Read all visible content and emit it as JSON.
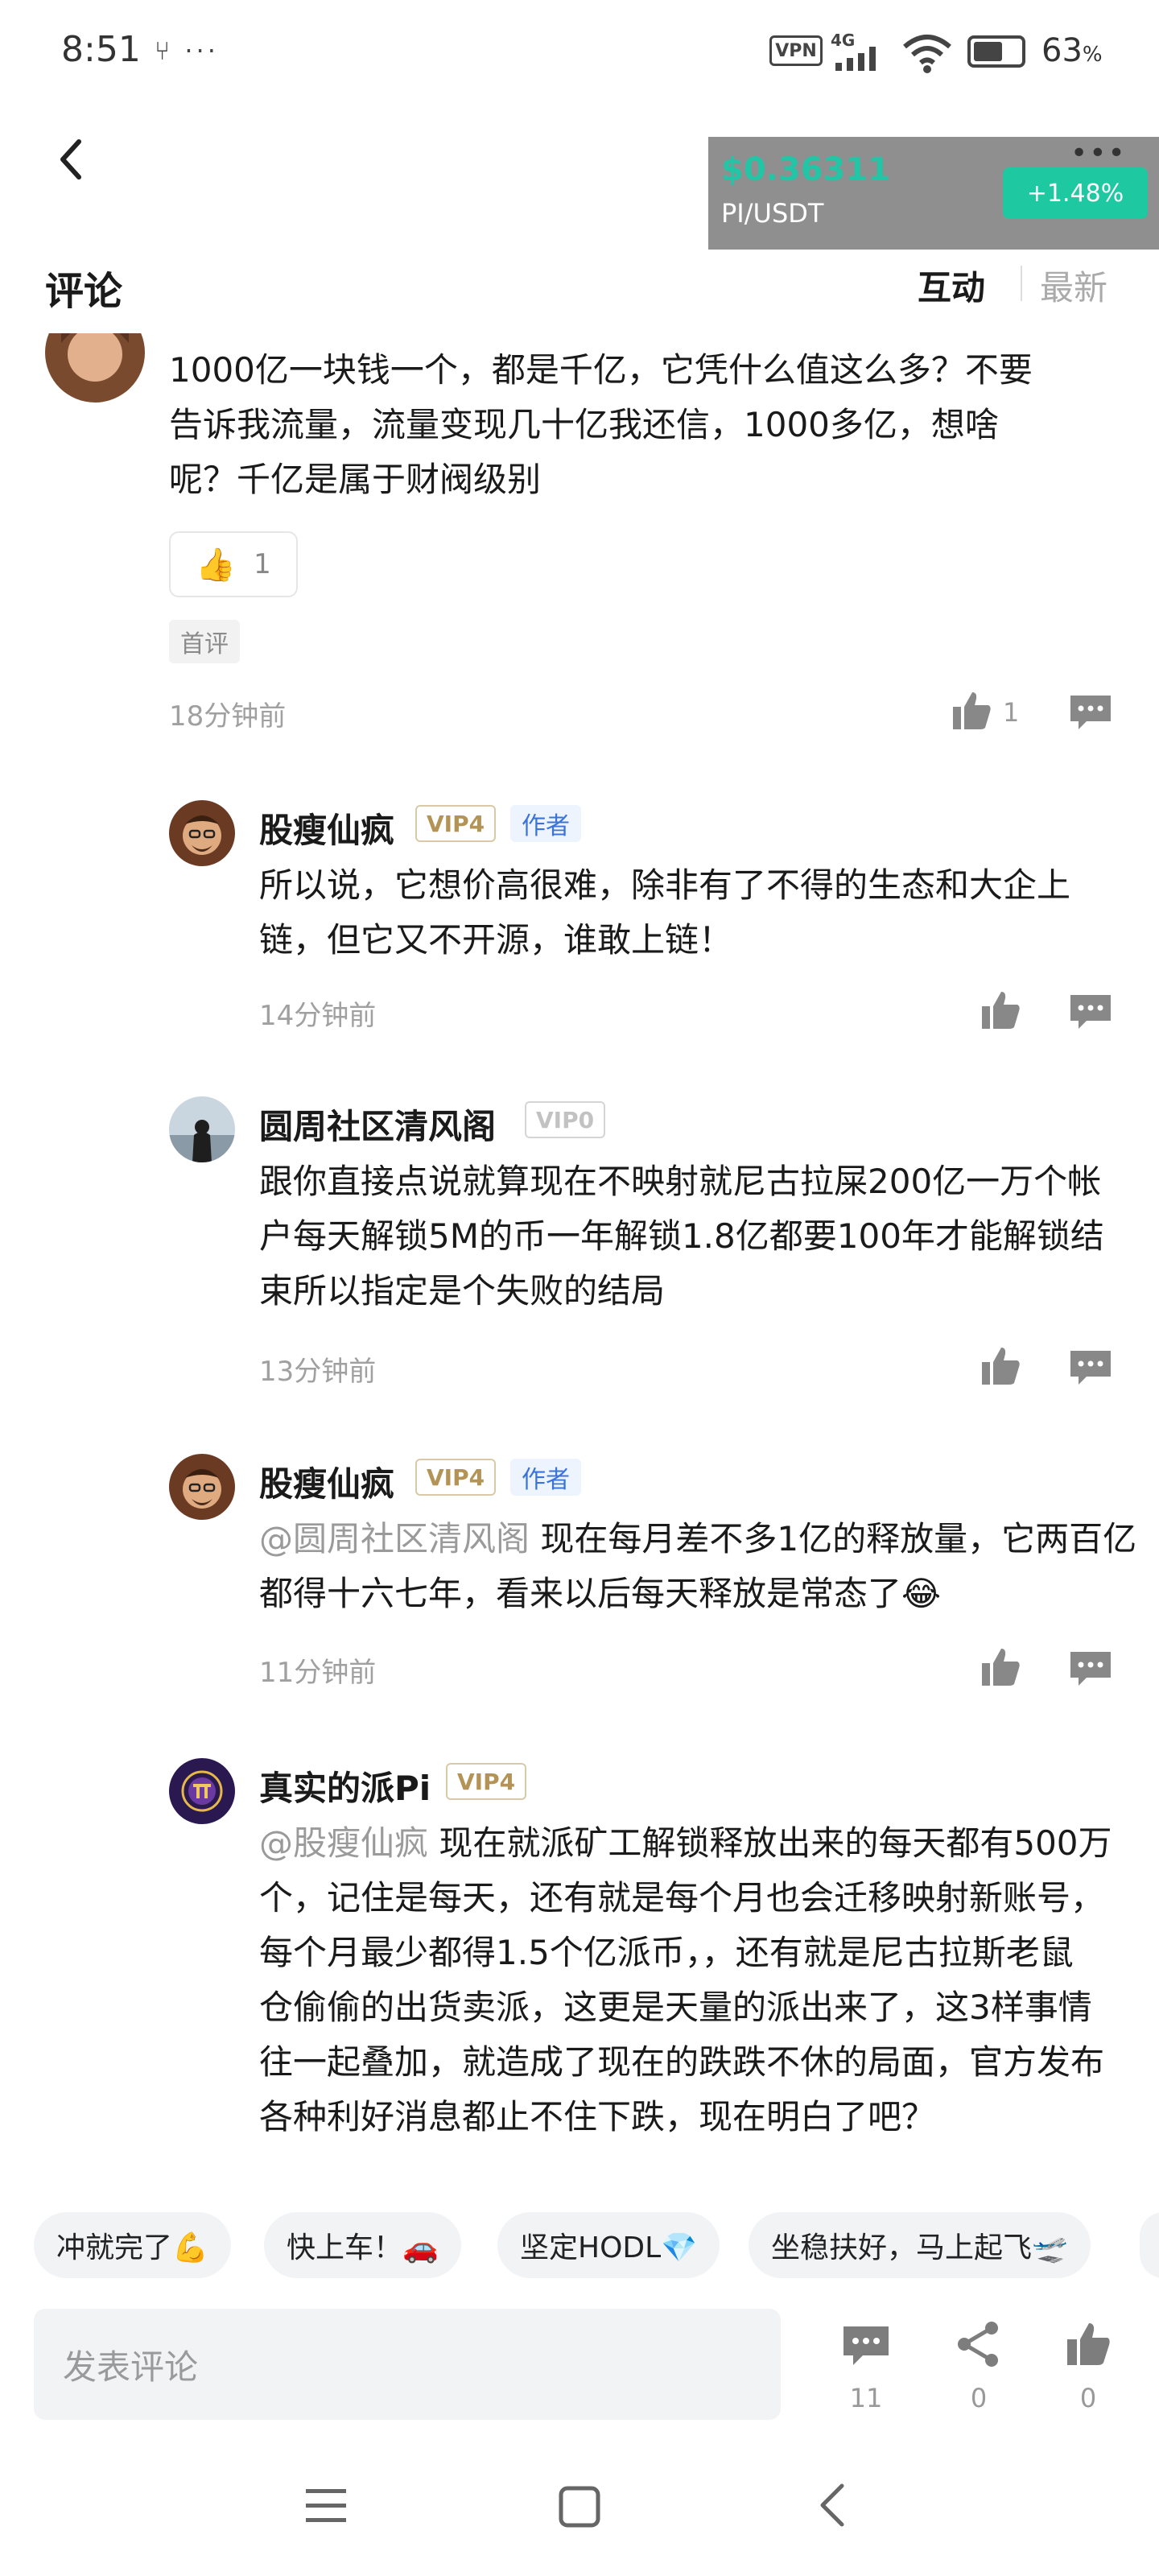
{
  "status_bar": {
    "time": "8:51",
    "extra_icons": "⑂ ···",
    "vpn": "VPN",
    "network": "4G",
    "battery": "63",
    "battery_unit": "%",
    "battery_level": 0.63
  },
  "header": {
    "price": "$0.36311",
    "pair": "PI/USDT",
    "change": "+1.48%",
    "more": "•••"
  },
  "section": {
    "title": "评论",
    "sort_hot": "互动",
    "sort_new": "最新"
  },
  "comments": [
    {
      "text_lines": [
        "1000亿一块钱一个，都是千亿，它凭什么值这么多？不要",
        "告诉我流量，流量变现几十亿我还信，1000多亿，想啥",
        "呢？千亿是属于财阀级别"
      ],
      "reaction_emoji": "👍",
      "reaction_count": "1",
      "tag": "首评",
      "time": "18分钟前",
      "like_count": "1"
    },
    {
      "username": "股瘦仙疯",
      "vip": "VIP4",
      "badge": "作者",
      "text_lines": [
        "所以说，它想价高很难，除非有了不得的生态和大企上",
        "链，但它又不开源，谁敢上链！"
      ],
      "time": "14分钟前"
    },
    {
      "username": "圆周社区清风阁",
      "vip": "VIP0",
      "text_lines": [
        "跟你直接点说就算现在不映射就尼古拉屎200亿一万个帐",
        "户每天解锁5M的币一年解锁1.8亿都要100年才能解锁结",
        "束所以指定是个失败的结局"
      ],
      "time": "13分钟前"
    },
    {
      "username": "股瘦仙疯",
      "vip": "VIP4",
      "badge": "作者",
      "mention": "@圆周社区清风阁",
      "text_first": " 现在每月差不多1亿的释放量，它两百亿",
      "text_lines": [
        "都得十六七年，看来以后每天释放是常态了😂"
      ],
      "time": "11分钟前"
    },
    {
      "username": "真实的派Pi",
      "vip": "VIP4",
      "mention": "@股瘦仙疯",
      "text_first": " 现在就派矿工解锁释放出来的每天都有500万",
      "text_lines": [
        "个，记住是每天，还有就是每个月也会迁移映射新账号，",
        "每个月最少都得1.5个亿派币，，还有就是尼古拉斯老鼠",
        "仓偷偷的出货卖派，这更是天量的派出来了，这3样事情",
        "往一起叠加，就造成了现在的跌跌不休的局面，官方发布",
        "各种利好消息都止不住下跌，现在明白了吧？"
      ]
    }
  ],
  "quick_replies": [
    "冲就完了💪",
    "快上车！🚗",
    "坚定HODL💎",
    "坐稳扶好，马上起飞🛫"
  ],
  "bottom_bar": {
    "placeholder": "发表评论",
    "comment_count": "11",
    "share_count": "0",
    "like_count": "0"
  }
}
